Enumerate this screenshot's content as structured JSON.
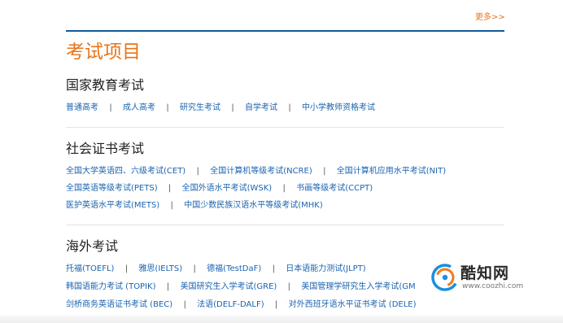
{
  "header": {
    "more_label": "更多>>",
    "title": "考试项目"
  },
  "sections": [
    {
      "title": "国家教育考试",
      "rows": [
        [
          "普通高考",
          "成人高考",
          "研究生考试",
          "自学考试",
          "中小学教师资格考试"
        ]
      ]
    },
    {
      "title": "社会证书考试",
      "rows": [
        [
          "全国大学英语四、六级考试(CET)",
          "全国计算机等级考试(NCRE)",
          "全国计算机应用水平考试(NIT)"
        ],
        [
          "全国英语等级考试(PETS)",
          "全国外语水平考试(WSK)",
          "书画等级考试(CCPT)"
        ],
        [
          "医护英语水平考试(METS)",
          "中国少数民族汉语水平等级考试(MHK)"
        ]
      ]
    },
    {
      "title": "海外考试",
      "rows": [
        [
          "托福(TOEFL)",
          "雅思(IELTS)",
          "德福(TestDaF)",
          "日本语能力测试(JLPT)"
        ],
        [
          "韩国语能力考试 (TOPIK)",
          "美国研究生入学考试(GRE)",
          "美国管理学研究生入学考试(GM"
        ],
        [
          "剑桥商务英语证书考试 (BEC)",
          "法语(DELF-DALF)",
          "对外西班牙语水平证书考试 (DELE)"
        ]
      ]
    }
  ],
  "separator": "|",
  "watermark": {
    "name": "酷知网",
    "url": "www.coozhi.com",
    "icon": "coozhi-logo-icon"
  },
  "colors": {
    "accent_orange": "#e8751a",
    "link_blue": "#1a63b0",
    "rule_blue": "#14589a"
  }
}
